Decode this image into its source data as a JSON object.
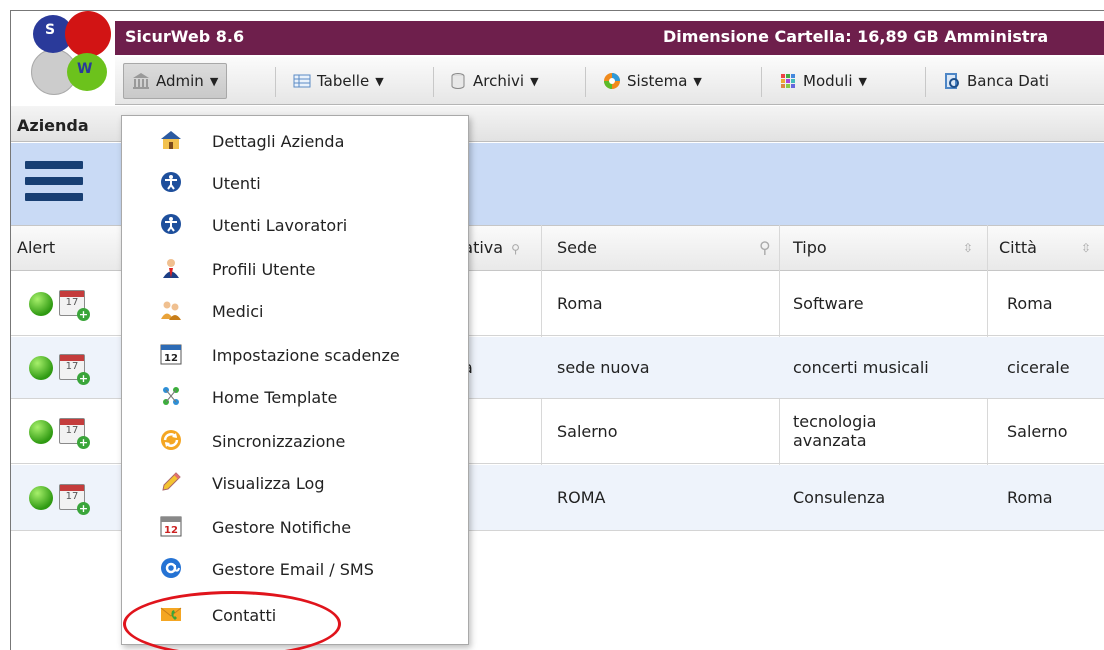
{
  "app": {
    "logo_letters": [
      "S",
      "W"
    ],
    "title": "SicurWeb 8.6",
    "info": "Dimensione Cartella: 16,89 GB Amministra"
  },
  "menubar": [
    {
      "label": "Admin",
      "icon": "bank-icon",
      "caret": true
    },
    {
      "label": "Tabelle",
      "icon": "table-icon",
      "caret": true
    },
    {
      "label": "Archivi",
      "icon": "database-icon",
      "caret": true
    },
    {
      "label": "Sistema",
      "icon": "system-icon",
      "caret": true
    },
    {
      "label": "Moduli",
      "icon": "grid-icon",
      "caret": true
    },
    {
      "label": "Banca Dati",
      "icon": "book-icon",
      "caret": false
    }
  ],
  "panel": {
    "title": "Azienda"
  },
  "table": {
    "headers": [
      "Alert",
      "tativa",
      "Sede",
      "Tipo",
      "Città"
    ],
    "rows": [
      {
        "calendar": "17",
        "extra": "",
        "sede": "Roma",
        "tipo": "Software",
        "citta": "Roma"
      },
      {
        "calendar": "17",
        "extra": "a",
        "sede": "sede nuova",
        "tipo": "concerti musicali",
        "citta": "cicerale"
      },
      {
        "calendar": "17",
        "extra": "",
        "sede": "Salerno",
        "tipo": "tecnologia avanzata",
        "citta": "Salerno"
      },
      {
        "calendar": "17",
        "extra": "",
        "sede": "ROMA",
        "tipo": "Consulenza",
        "citta": "Roma"
      }
    ]
  },
  "dropdown": {
    "items": [
      {
        "label": "Dettagli Azienda",
        "icon": "building-icon"
      },
      {
        "label": "Utenti",
        "icon": "user-accessibility-icon"
      },
      {
        "label": "Utenti Lavoratori",
        "icon": "user-accessibility-icon"
      },
      {
        "label": "Profili Utente",
        "icon": "user-profile-icon"
      },
      {
        "label": "Medici",
        "icon": "doctors-icon"
      },
      {
        "label": "Impostazione scadenze",
        "icon": "calendar-icon",
        "icon_text": "12"
      },
      {
        "label": "Home Template",
        "icon": "template-icon"
      },
      {
        "label": "Sincronizzazione",
        "icon": "sync-icon"
      },
      {
        "label": "Visualizza Log",
        "icon": "pencil-icon"
      },
      {
        "label": "Gestore Notifiche",
        "icon": "notification-calendar-icon",
        "icon_text": "12"
      },
      {
        "label": "Gestore Email / SMS",
        "icon": "email-icon"
      },
      {
        "label": "Contatti",
        "icon": "contacts-icon"
      }
    ]
  },
  "colors": {
    "title_bar": "#6e1f4c",
    "highlight": "#e0141c",
    "panel_band": "#c9daf5"
  }
}
